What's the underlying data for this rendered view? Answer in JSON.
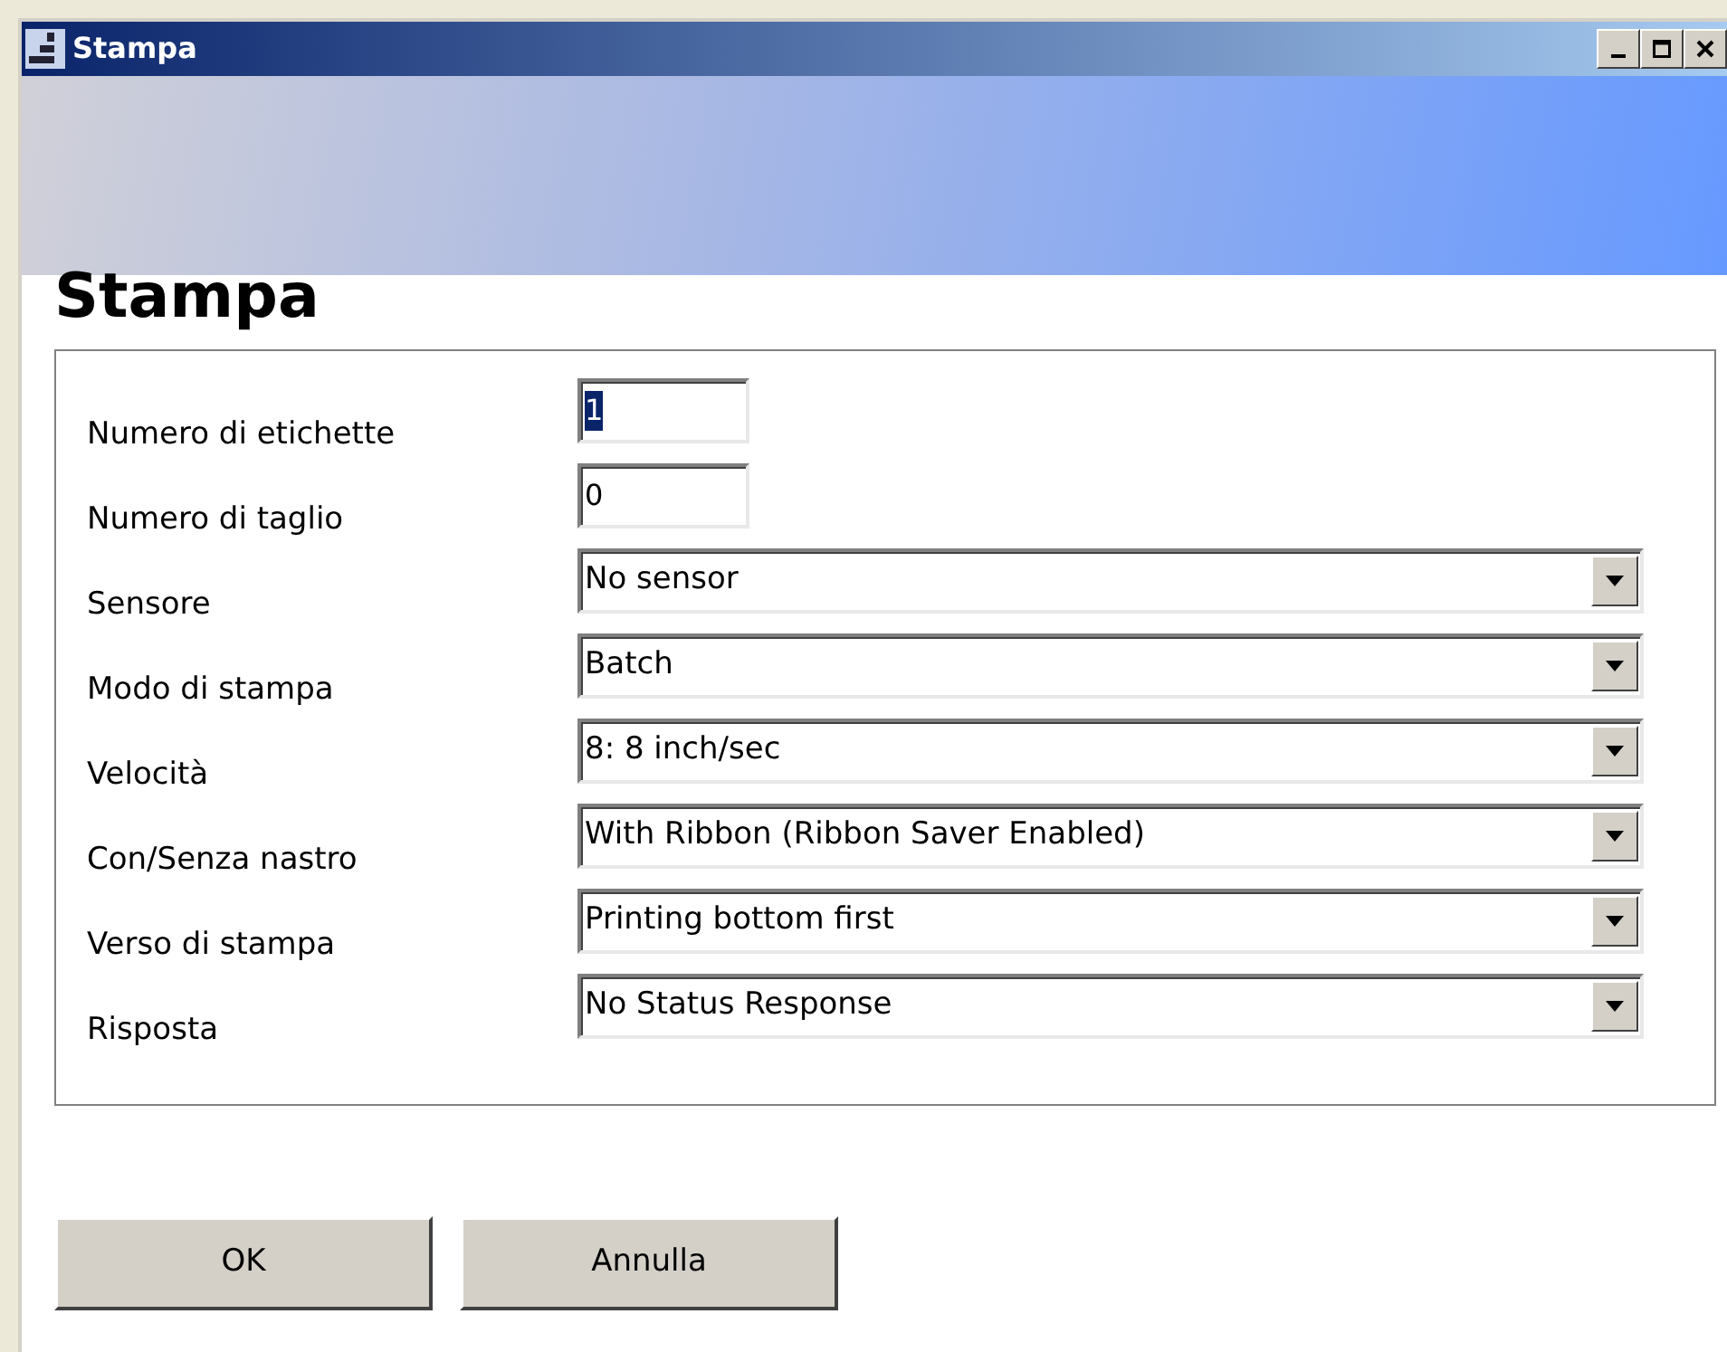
{
  "window": {
    "title": "Stampa"
  },
  "heading": "Stampa",
  "fields": [
    {
      "kind": "text",
      "label": "Numero di etichette",
      "value": "1",
      "text_selected": true
    },
    {
      "kind": "text",
      "label": "Numero di taglio",
      "value": "0",
      "text_selected": false
    },
    {
      "kind": "dropdown",
      "label": "Sensore",
      "value": "No sensor"
    },
    {
      "kind": "dropdown",
      "label": "Modo di stampa",
      "value": "Batch"
    },
    {
      "kind": "dropdown",
      "label": "Velocità",
      "value": "8: 8 inch/sec"
    },
    {
      "kind": "dropdown",
      "label": "Con/Senza nastro",
      "value": "With Ribbon (Ribbon Saver Enabled)"
    },
    {
      "kind": "dropdown",
      "label": "Verso di stampa",
      "value": "Printing bottom first"
    },
    {
      "kind": "dropdown",
      "label": "Risposta",
      "value": "No Status Response"
    }
  ],
  "buttons": [
    "OK",
    "Annulla"
  ]
}
